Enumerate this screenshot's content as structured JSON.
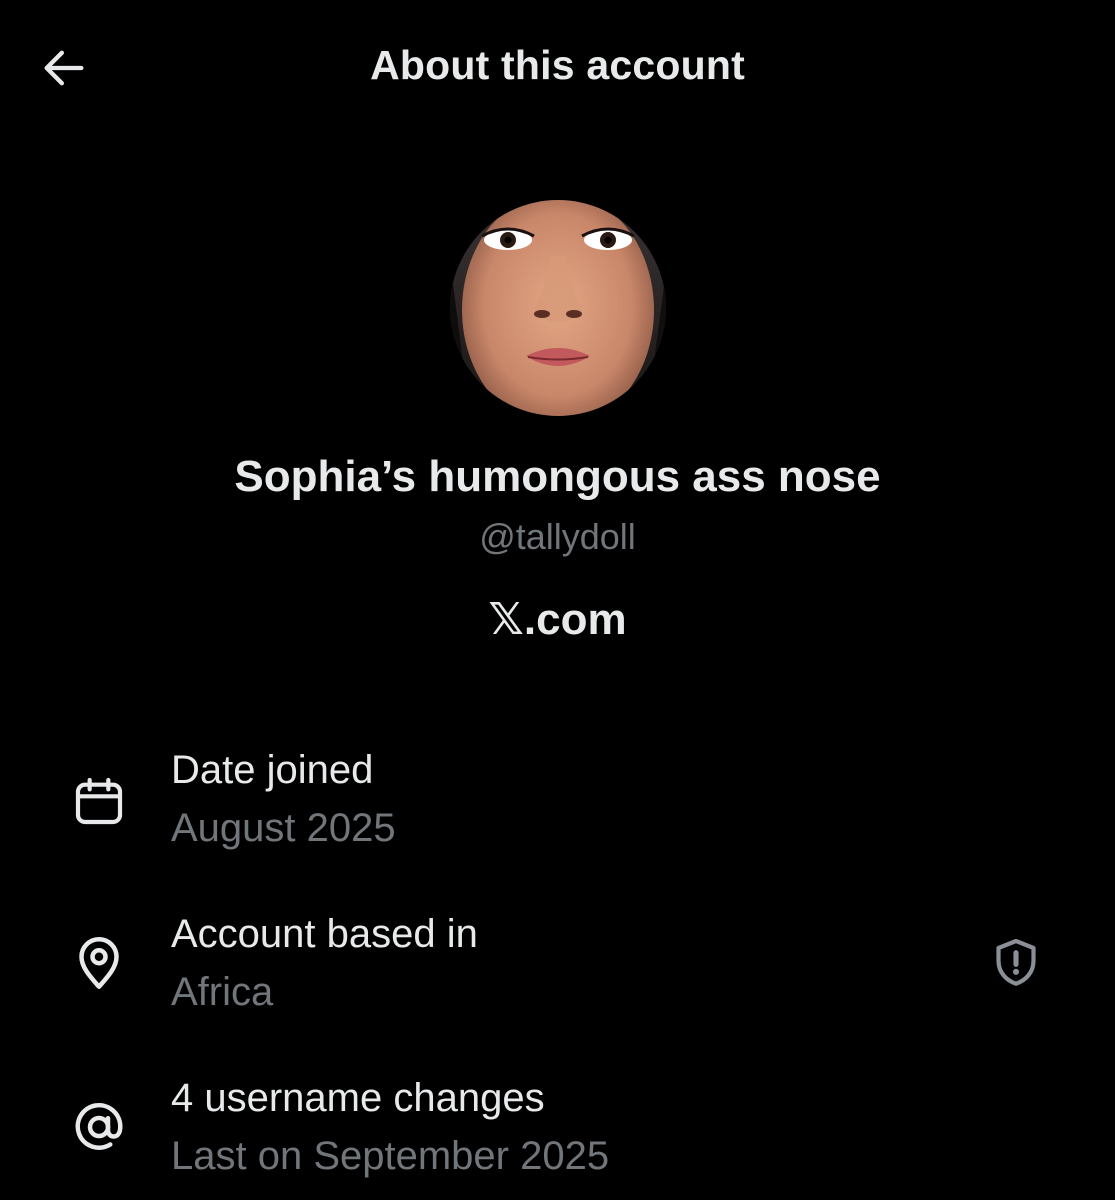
{
  "header": {
    "back_icon": "arrow-left-icon",
    "title": "About this account"
  },
  "profile": {
    "display_name": "Sophia’s humongous ass nose",
    "handle": "@tallydoll",
    "platform": "𝕏.com"
  },
  "details": [
    {
      "icon": "calendar-icon",
      "label": "Date joined",
      "value": "August 2025"
    },
    {
      "icon": "location-pin-icon",
      "label": "Account based in",
      "value": "Africa",
      "trailing_icon": "shield-alert-icon"
    },
    {
      "icon": "at-sign-icon",
      "label": "4 username changes",
      "value": "Last on September 2025"
    }
  ],
  "colors": {
    "background": "#000000",
    "primary_text": "#e7e9ea",
    "secondary_text": "#71767b"
  }
}
